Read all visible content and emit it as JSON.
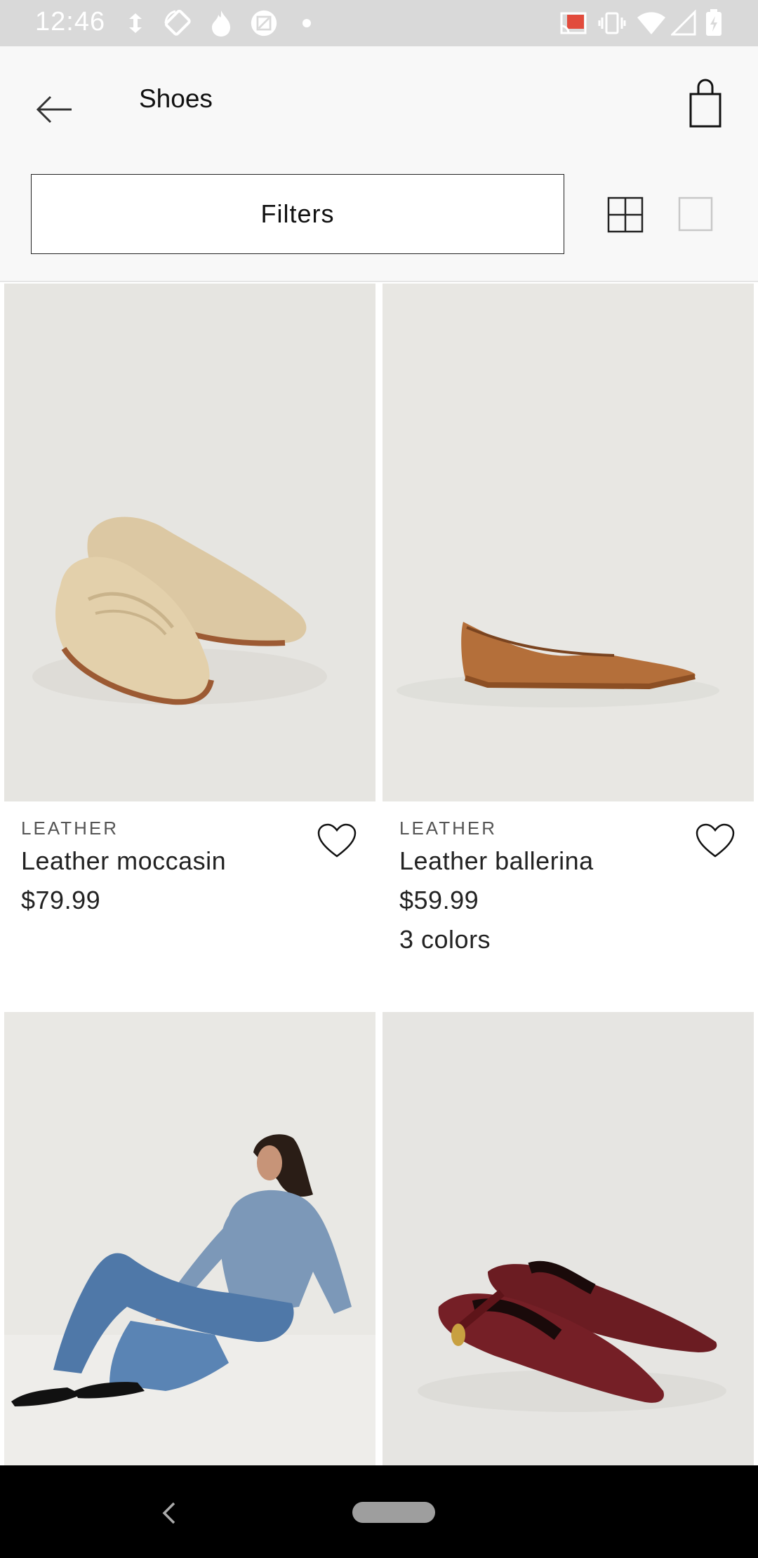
{
  "status_bar": {
    "time": "12:46",
    "left_icons": [
      "data-saver-icon",
      "rotate-icon",
      "flame-icon",
      "photo-app-icon",
      "dot-icon"
    ],
    "right_icons": [
      "cast-icon",
      "vibrate-icon",
      "wifi-icon",
      "signal-icon",
      "battery-icon"
    ]
  },
  "header": {
    "title": "Shoes",
    "back_icon": "arrow-left-icon",
    "bag_icon": "shopping-bag-icon"
  },
  "toolbar": {
    "filters_label": "Filters",
    "grid_view_icon": "grid-view-icon",
    "single_view_icon": "single-view-icon"
  },
  "products": [
    {
      "category": "LEATHER",
      "name": "Leather moccasin",
      "price": "$79.99",
      "colors": "",
      "image": "beige leather moccasin loafers",
      "bg": "#e6e5e1"
    },
    {
      "category": "LEATHER",
      "name": "Leather ballerina",
      "price": "$59.99",
      "colors": "3 colors",
      "image": "tan leather ballerina flat",
      "bg": "#e8e7e3"
    },
    {
      "image": "model in denim wearing black flats",
      "bg": "#e9e8e4"
    },
    {
      "image": "burgundy croc mary jane flats",
      "bg": "#e6e5e2"
    }
  ],
  "nav_bar": {
    "back_icon": "nav-back-icon",
    "home_icon": "home-pill-icon"
  }
}
